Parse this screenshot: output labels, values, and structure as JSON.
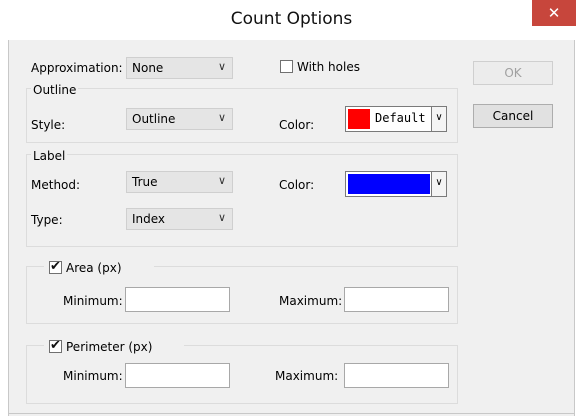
{
  "window": {
    "title": "Count Options",
    "close_glyph": "✕"
  },
  "approximation": {
    "label": "Approximation:",
    "value": "None"
  },
  "with_holes": {
    "label": "With holes",
    "checked": false
  },
  "buttons": {
    "ok": "OK",
    "cancel": "Cancel"
  },
  "outline": {
    "group_label": "Outline",
    "style_label": "Style:",
    "style_value": "Outline",
    "color_label": "Color:",
    "color_value": "Default",
    "color_hex": "#ff0000"
  },
  "label": {
    "group_label": "Label",
    "method_label": "Method:",
    "method_value": "True",
    "color_label": "Color:",
    "color_hex": "#0000ff",
    "type_label": "Type:",
    "type_value": "Index"
  },
  "area": {
    "label": "Area (px)",
    "checked": true,
    "minimum_label": "Minimum:",
    "minimum_value": "",
    "maximum_label": "Maximum:",
    "maximum_value": ""
  },
  "perimeter": {
    "label": "Perimeter (px)",
    "checked": true,
    "minimum_label": "Minimum:",
    "minimum_value": "",
    "maximum_label": "Maximum:",
    "maximum_value": ""
  },
  "icons": {
    "dropdown": "chevron-down-icon",
    "check": "checkmark-icon",
    "close": "close-icon"
  }
}
